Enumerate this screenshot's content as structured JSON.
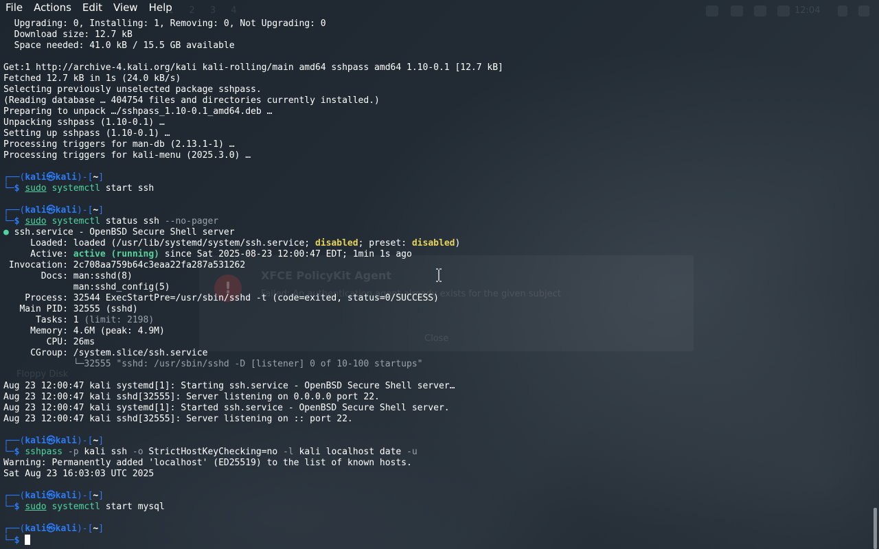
{
  "menubar": {
    "items": [
      "File",
      "Actions",
      "Edit",
      "View",
      "Help"
    ]
  },
  "background": {
    "workspaces": [
      "1",
      "2",
      "3",
      "4"
    ],
    "clock": "12:04",
    "dialog_title": "XFCE PolicyKit Agent",
    "dialog_text": "Failed: An authentication agent already exists for the given subject",
    "dialog_close": "Close",
    "desktop_icon": "Floppy Disk"
  },
  "terminal": {
    "lines": [
      [
        {
          "t": "  Upgrading: 0, Installing: 1, Removing: 0, Not Upgrading: 0"
        }
      ],
      [
        {
          "t": "  Download size: 12.7 kB"
        }
      ],
      [
        {
          "t": "  Space needed: 41.0 kB / 15.5 GB available"
        }
      ],
      [],
      [
        {
          "t": "Get:1 http://archive-4.kali.org/kali kali-rolling/main amd64 sshpass amd64 1.10-0.1 [12.7 kB]"
        }
      ],
      [
        {
          "t": "Fetched 12.7 kB in 1s (24.0 kB/s)"
        }
      ],
      [
        {
          "t": "Selecting previously unselected package sshpass."
        }
      ],
      [
        {
          "t": "(Reading database … 404754 files and directories currently installed.)"
        }
      ],
      [
        {
          "t": "Preparing to unpack …/sshpass_1.10-0.1_amd64.deb …"
        }
      ],
      [
        {
          "t": "Unpacking sshpass (1.10-0.1) …"
        }
      ],
      [
        {
          "t": "Setting up sshpass (1.10-0.1) …"
        }
      ],
      [
        {
          "t": "Processing triggers for man-db (2.13.1-1) …"
        }
      ],
      [
        {
          "t": "Processing triggers for kali-menu (2025.3.0) …"
        }
      ],
      [],
      [
        {
          "t": "┌──(",
          "c": "blue"
        },
        {
          "t": "kali㉿kali",
          "c": "blue-b"
        },
        {
          "t": ")-[",
          "c": "blue"
        },
        {
          "t": "~",
          "c": "white-b"
        },
        {
          "t": "]",
          "c": "blue"
        }
      ],
      [
        {
          "t": "└─",
          "c": "blue"
        },
        {
          "t": "$ ",
          "c": "blue-b"
        },
        {
          "t": "sudo",
          "c": "green-u"
        },
        {
          "t": " systemctl",
          "c": "green"
        },
        {
          "t": " start ssh"
        }
      ],
      [],
      [
        {
          "t": "┌──(",
          "c": "blue"
        },
        {
          "t": "kali㉿kali",
          "c": "blue-b"
        },
        {
          "t": ")-[",
          "c": "blue"
        },
        {
          "t": "~",
          "c": "white-b"
        },
        {
          "t": "]",
          "c": "blue"
        }
      ],
      [
        {
          "t": "└─",
          "c": "blue"
        },
        {
          "t": "$ ",
          "c": "blue-b"
        },
        {
          "t": "sudo",
          "c": "green-u"
        },
        {
          "t": " systemctl",
          "c": "green"
        },
        {
          "t": " status ssh "
        },
        {
          "t": "--no-pager",
          "c": "gray"
        }
      ],
      [
        {
          "t": "●",
          "c": "green"
        },
        {
          "t": " ssh.service - OpenBSD Secure Shell server"
        }
      ],
      [
        {
          "t": "     Loaded: loaded (/usr/lib/systemd/system/ssh.service; "
        },
        {
          "t": "disabled",
          "c": "yellow-b"
        },
        {
          "t": "; preset: "
        },
        {
          "t": "disabled",
          "c": "yellow-b"
        },
        {
          "t": ")"
        }
      ],
      [
        {
          "t": "     Active: "
        },
        {
          "t": "active (running)",
          "c": "green-b"
        },
        {
          "t": " since Sat 2025-08-23 12:00:47 EDT; 1min 1s ago"
        }
      ],
      [
        {
          "t": " Invocation: 2c708aa759b64c3eaa22fa287a531262"
        }
      ],
      [
        {
          "t": "       Docs: man:sshd(8)"
        }
      ],
      [
        {
          "t": "             man:sshd_config(5)"
        }
      ],
      [
        {
          "t": "    Process: 32544 ExecStartPre=/usr/sbin/sshd -t (code=exited, status=0/SUCCESS)"
        }
      ],
      [
        {
          "t": "   Main PID: 32555 (sshd)"
        }
      ],
      [
        {
          "t": "      Tasks: 1 "
        },
        {
          "t": "(limit: 2198)",
          "c": "gray"
        }
      ],
      [
        {
          "t": "     Memory: 4.6M (peak: 4.9M)"
        }
      ],
      [
        {
          "t": "        CPU: 26ms"
        }
      ],
      [
        {
          "t": "     CGroup: /system.slice/ssh.service"
        }
      ],
      [
        {
          "t": "             └─32555 \"sshd: /usr/sbin/sshd -D [listener] 0 of 10-100 startups\"",
          "c": "gray"
        }
      ],
      [],
      [
        {
          "t": "Aug 23 12:00:47 kali systemd[1]: Starting ssh.service - OpenBSD Secure Shell server…"
        }
      ],
      [
        {
          "t": "Aug 23 12:00:47 kali sshd[32555]: Server listening on 0.0.0.0 port 22."
        }
      ],
      [
        {
          "t": "Aug 23 12:00:47 kali systemd[1]: Started ssh.service - OpenBSD Secure Shell server."
        }
      ],
      [
        {
          "t": "Aug 23 12:00:47 kali sshd[32555]: Server listening on :: port 22."
        }
      ],
      [],
      [
        {
          "t": "┌──(",
          "c": "blue"
        },
        {
          "t": "kali㉿kali",
          "c": "blue-b"
        },
        {
          "t": ")-[",
          "c": "blue"
        },
        {
          "t": "~",
          "c": "white-b"
        },
        {
          "t": "]",
          "c": "blue"
        }
      ],
      [
        {
          "t": "└─",
          "c": "blue"
        },
        {
          "t": "$ ",
          "c": "blue-b"
        },
        {
          "t": "sshpass",
          "c": "green"
        },
        {
          "t": " -p",
          "c": "gray"
        },
        {
          "t": " kali ssh "
        },
        {
          "t": "-o",
          "c": "gray"
        },
        {
          "t": " StrictHostKeyChecking=no "
        },
        {
          "t": "-l",
          "c": "gray"
        },
        {
          "t": " kali localhost date "
        },
        {
          "t": "-u",
          "c": "gray"
        }
      ],
      [
        {
          "t": "Warning: Permanently added 'localhost' (ED25519) to the list of known hosts."
        }
      ],
      [
        {
          "t": "Sat Aug 23 16:03:03 UTC 2025"
        }
      ],
      [],
      [
        {
          "t": "┌──(",
          "c": "blue"
        },
        {
          "t": "kali㉿kali",
          "c": "blue-b"
        },
        {
          "t": ")-[",
          "c": "blue"
        },
        {
          "t": "~",
          "c": "white-b"
        },
        {
          "t": "]",
          "c": "blue"
        }
      ],
      [
        {
          "t": "└─",
          "c": "blue"
        },
        {
          "t": "$ ",
          "c": "blue-b"
        },
        {
          "t": "sudo",
          "c": "green-u"
        },
        {
          "t": " systemctl",
          "c": "green"
        },
        {
          "t": " start mysql"
        }
      ],
      [],
      [
        {
          "t": "┌──(",
          "c": "blue"
        },
        {
          "t": "kali㉿kali",
          "c": "blue-b"
        },
        {
          "t": ")-[",
          "c": "blue"
        },
        {
          "t": "~",
          "c": "white-b"
        },
        {
          "t": "]",
          "c": "blue"
        }
      ],
      [
        {
          "t": "└─",
          "c": "blue"
        },
        {
          "t": "$ ",
          "c": "blue-b"
        },
        {
          "t": "",
          "c": "cursor"
        }
      ]
    ]
  },
  "colors": {
    "prompt_blue": "#2b7bf6",
    "command_green": "#4fd6a0",
    "status_active": "#58d29c",
    "status_disabled": "#e6d35a",
    "muted_gray": "#9aa3ac",
    "background": "#1a222b"
  }
}
